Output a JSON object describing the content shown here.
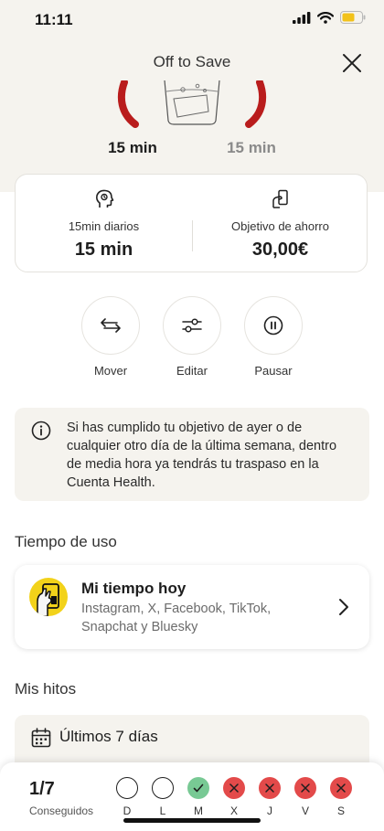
{
  "status_bar": {
    "time": "11:11"
  },
  "header": {
    "title": "Off to Save",
    "accent_color": "#b91c1c"
  },
  "goals": {
    "current": "15 min",
    "target": "15 min"
  },
  "summary": {
    "daily_label": "15min diarios",
    "daily_value": "15 min",
    "savings_label": "Objetivo de ahorro",
    "savings_value": "30,00€"
  },
  "actions": [
    {
      "label": "Mover",
      "icon": "swap-arrows-icon"
    },
    {
      "label": "Editar",
      "icon": "sliders-icon"
    },
    {
      "label": "Pausar",
      "icon": "pause-icon"
    }
  ],
  "info": {
    "text": "Si has cumplido tu objetivo de ayer o de cualquier otro día de la última semana, dentro de media hora ya tendrás tu traspaso en la Cuenta Health."
  },
  "usage": {
    "section_title": "Tiempo de uso",
    "title": "Mi tiempo hoy",
    "subtitle": "Instagram, X, Facebook, TikTok, Snapchat y Bluesky"
  },
  "milestones": {
    "section_title": "Mis hitos",
    "period_label": "Últimos 7 días",
    "count": "1/7",
    "count_label": "Conseguidos",
    "days": [
      {
        "label": "D",
        "status": "none"
      },
      {
        "label": "L",
        "status": "none"
      },
      {
        "label": "M",
        "status": "ok"
      },
      {
        "label": "X",
        "status": "fail"
      },
      {
        "label": "J",
        "status": "fail"
      },
      {
        "label": "V",
        "status": "fail"
      },
      {
        "label": "S",
        "status": "fail"
      }
    ],
    "colors": {
      "ok": "#78c994",
      "fail": "#e34a4a"
    }
  }
}
